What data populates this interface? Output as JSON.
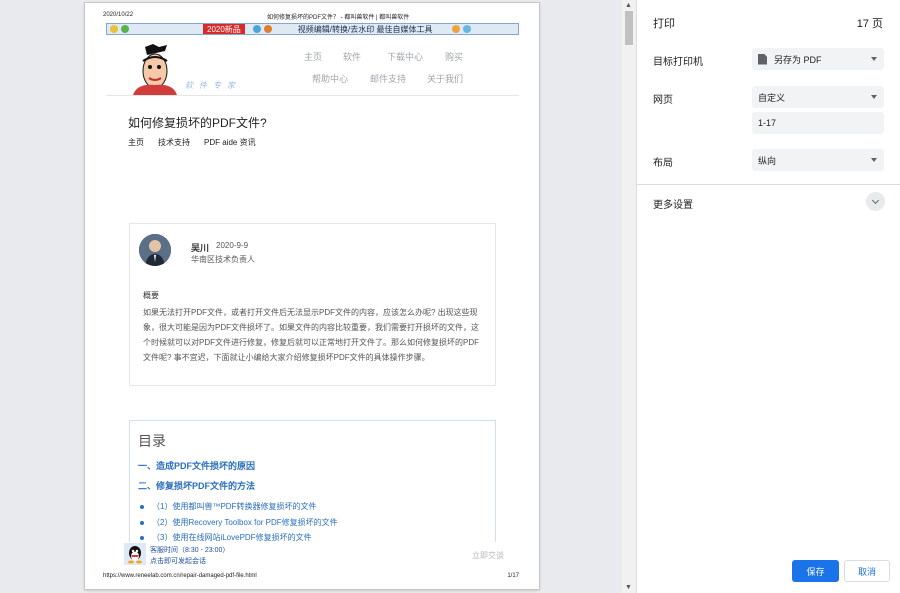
{
  "page": {
    "header_date": "2020/10/22",
    "header_title": "如何修复损坏的PDF文件？ - 都叫兽软件 | 都叫兽软件",
    "footer_url": "https://www.reneelab.com.cn/repair-damaged-pdf-file.html",
    "footer_page": "1/17",
    "banner": {
      "new": "2020新品",
      "text": "视频编辑/转换/去水印 最佳自媒体工具"
    },
    "logo_text": "软件专家",
    "nav": {
      "row1": [
        "主页",
        "软件",
        "下载中心",
        "购买"
      ],
      "row2": [
        "帮助中心",
        "邮件支持",
        "关于我们"
      ]
    },
    "article_title": "如何修复损坏的PDF文件?",
    "breadcrumb": [
      "主页",
      "技术支持",
      "PDF aide 资讯"
    ],
    "author": {
      "name": "吴川",
      "date": "2020-9-9",
      "role": "华南区技术负责人"
    },
    "summary_heading": "概要",
    "summary_text": "如果无法打开PDF文件，或者打开文件后无法显示PDF文件的内容，应该怎么办呢? 出现这些现象，很大可能是因为PDF文件损坏了。如果文件的内容比较重要，我们需要打开损坏的文件，这个时候就可以对PDF文件进行修复，修复后就可以正常地打开文件了。那么如何修复损坏的PDF文件呢? 事不宜迟，下面就让小编给大家介绍修复损坏PDF文件的具体操作步骤。",
    "toc": {
      "title": "目录",
      "heading1": "一、造成PDF文件损坏的原因",
      "heading2": "二、修复损坏PDF文件的方法",
      "items": [
        "（1）使用都叫兽™PDF转换器修复损坏的文件",
        "（2）使用Recovery Toolbox for PDF修复损坏的文件",
        "（3）使用在线网站iLovePDF修复损坏的文件"
      ]
    },
    "chat": {
      "time": "客服时间（8:30 - 23:00）",
      "go": "点击即可发起会话",
      "now": "立即交谈"
    }
  },
  "panel": {
    "title": "打印",
    "page_count": "17 页",
    "destination_label": "目标打印机",
    "destination_value": "另存为 PDF",
    "pages_label": "网页",
    "pages_value": "自定义",
    "pages_range": "1-17",
    "layout_label": "布局",
    "layout_value": "纵向",
    "more_settings": "更多设置",
    "save": "保存",
    "cancel": "取消"
  },
  "colors": {
    "accent": "#1a73e8",
    "link": "#2a6fbd"
  }
}
